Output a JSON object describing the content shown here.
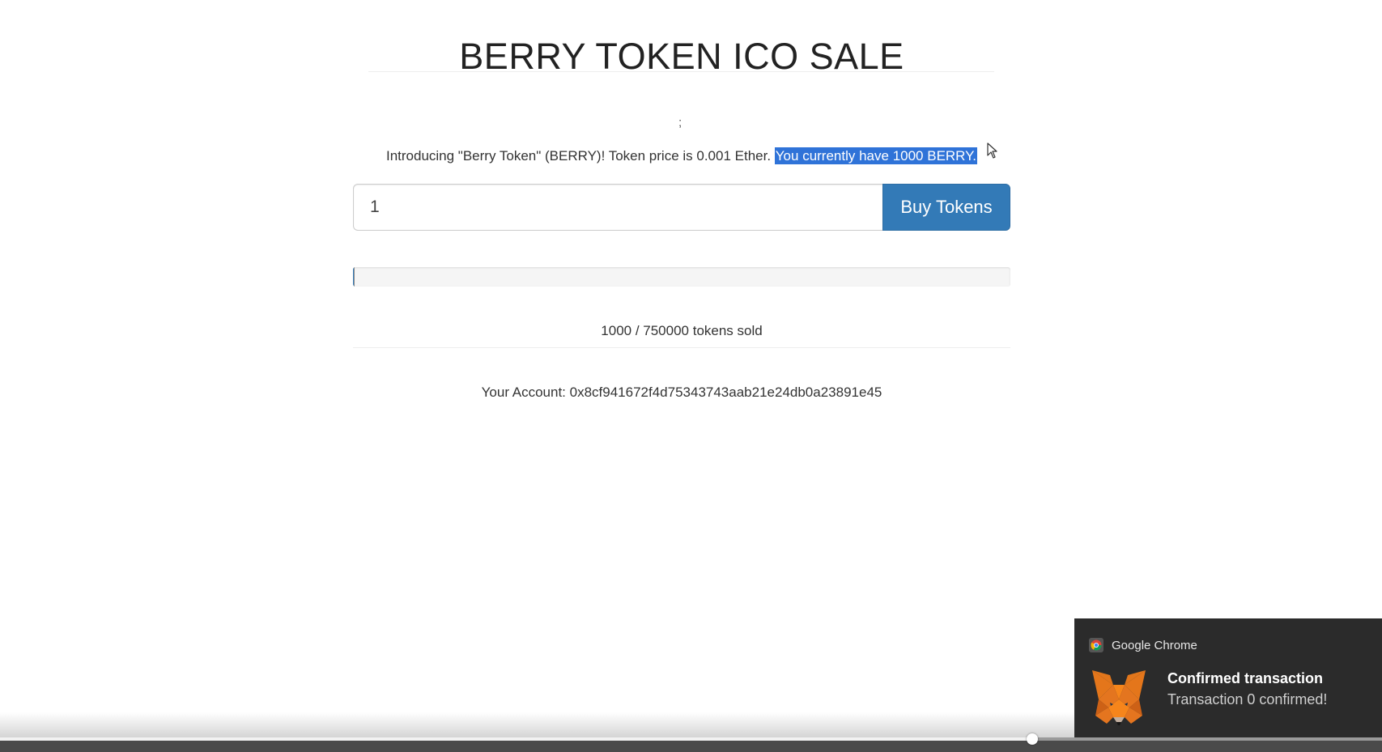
{
  "page": {
    "title": "BERRY TOKEN ICO SALE",
    "stray_char": ";",
    "intro_text": "Introducing \"Berry Token\" (BERRY)! Token price is 0.001 Ether. ",
    "balance_text": "You currently have 1000 BERRY."
  },
  "buy_form": {
    "quantity_value": "1",
    "buy_label": "Buy Tokens"
  },
  "progress": {
    "tokens_sold": 1000,
    "tokens_available": 750000,
    "fraction": 0.00133,
    "sold_text": "1000 / 750000 tokens sold"
  },
  "account": {
    "text": "Your Account: 0x8cf941672f4d75343743aab21e24db0a23891e45"
  },
  "notification": {
    "app_name": "Google Chrome",
    "title": "Confirmed transaction",
    "message": "Transaction 0 confirmed!"
  },
  "player": {
    "progress_fraction": 0.747
  },
  "colors": {
    "primary_button": "#337ab7",
    "selection": "#2f73d8",
    "toast_bg": "#2b2b2b"
  }
}
